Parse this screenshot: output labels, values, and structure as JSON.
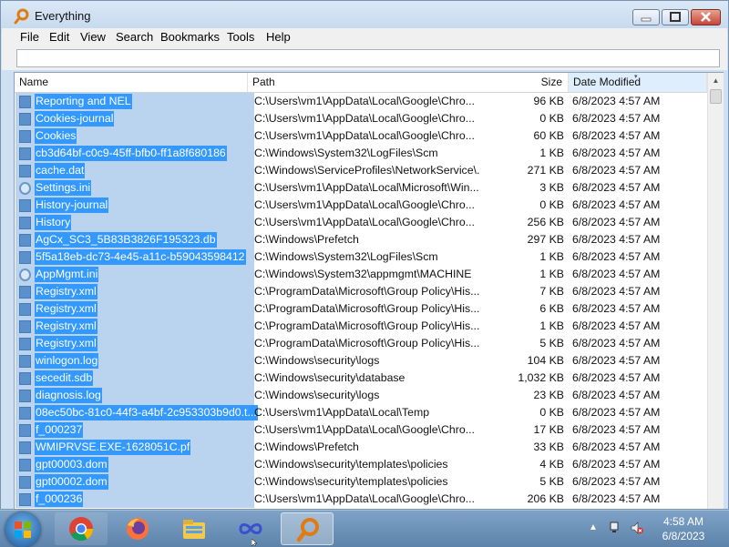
{
  "window": {
    "title": "Everything"
  },
  "menu": [
    "File",
    "Edit",
    "View",
    "Search",
    "Bookmarks",
    "Tools",
    "Help"
  ],
  "search": {
    "value": "",
    "placeholder": ""
  },
  "columns": {
    "name": "Name",
    "path": "Path",
    "size": "Size",
    "date": "Date Modified",
    "sorted_by": "Date Modified"
  },
  "rows": [
    {
      "name": "Reporting and NEL",
      "icon": "file-icon",
      "path": "C:\\Users\\vm1\\AppData\\Local\\Google\\Chro...",
      "size": "96 KB",
      "date": "6/8/2023 4:57 AM"
    },
    {
      "name": "Cookies-journal",
      "icon": "file-icon",
      "path": "C:\\Users\\vm1\\AppData\\Local\\Google\\Chro...",
      "size": "0 KB",
      "date": "6/8/2023 4:57 AM"
    },
    {
      "name": "Cookies",
      "icon": "file-icon",
      "path": "C:\\Users\\vm1\\AppData\\Local\\Google\\Chro...",
      "size": "60 KB",
      "date": "6/8/2023 4:57 AM"
    },
    {
      "name": "cb3d64bf-c0c9-45ff-bfb0-ff1a8f680186",
      "icon": "file-icon",
      "path": "C:\\Windows\\System32\\LogFiles\\Scm",
      "size": "1 KB",
      "date": "6/8/2023 4:57 AM"
    },
    {
      "name": "cache.dat",
      "icon": "file-icon",
      "path": "C:\\Windows\\ServiceProfiles\\NetworkService\\...",
      "size": "271 KB",
      "date": "6/8/2023 4:57 AM"
    },
    {
      "name": "Settings.ini",
      "icon": "settings-file-icon",
      "path": "C:\\Users\\vm1\\AppData\\Local\\Microsoft\\Win...",
      "size": "3 KB",
      "date": "6/8/2023 4:57 AM"
    },
    {
      "name": "History-journal",
      "icon": "file-icon",
      "path": "C:\\Users\\vm1\\AppData\\Local\\Google\\Chro...",
      "size": "0 KB",
      "date": "6/8/2023 4:57 AM"
    },
    {
      "name": "History",
      "icon": "file-icon",
      "path": "C:\\Users\\vm1\\AppData\\Local\\Google\\Chro...",
      "size": "256 KB",
      "date": "6/8/2023 4:57 AM"
    },
    {
      "name": "AgCx_SC3_5B83B3826F195323.db",
      "icon": "file-icon",
      "path": "C:\\Windows\\Prefetch",
      "size": "297 KB",
      "date": "6/8/2023 4:57 AM"
    },
    {
      "name": "5f5a18eb-dc73-4e45-a11c-b59043598412",
      "icon": "file-icon",
      "path": "C:\\Windows\\System32\\LogFiles\\Scm",
      "size": "1 KB",
      "date": "6/8/2023 4:57 AM"
    },
    {
      "name": "AppMgmt.ini",
      "icon": "settings-file-icon",
      "path": "C:\\Windows\\System32\\appmgmt\\MACHINE",
      "size": "1 KB",
      "date": "6/8/2023 4:57 AM"
    },
    {
      "name": "Registry.xml",
      "icon": "file-icon",
      "path": "C:\\ProgramData\\Microsoft\\Group Policy\\His...",
      "size": "7 KB",
      "date": "6/8/2023 4:57 AM"
    },
    {
      "name": "Registry.xml",
      "icon": "file-icon",
      "path": "C:\\ProgramData\\Microsoft\\Group Policy\\His...",
      "size": "6 KB",
      "date": "6/8/2023 4:57 AM"
    },
    {
      "name": "Registry.xml",
      "icon": "file-icon",
      "path": "C:\\ProgramData\\Microsoft\\Group Policy\\His...",
      "size": "1 KB",
      "date": "6/8/2023 4:57 AM"
    },
    {
      "name": "Registry.xml",
      "icon": "file-icon",
      "path": "C:\\ProgramData\\Microsoft\\Group Policy\\His...",
      "size": "5 KB",
      "date": "6/8/2023 4:57 AM"
    },
    {
      "name": "winlogon.log",
      "icon": "file-icon",
      "path": "C:\\Windows\\security\\logs",
      "size": "104 KB",
      "date": "6/8/2023 4:57 AM"
    },
    {
      "name": "secedit.sdb",
      "icon": "file-icon",
      "path": "C:\\Windows\\security\\database",
      "size": "1,032 KB",
      "date": "6/8/2023 4:57 AM"
    },
    {
      "name": "diagnosis.log",
      "icon": "file-icon",
      "path": "C:\\Windows\\security\\logs",
      "size": "23 KB",
      "date": "6/8/2023 4:57 AM"
    },
    {
      "name": "08ec50bc-81c0-44f3-a4bf-2c953303b9d0.t...",
      "icon": "file-icon",
      "path": "C:\\Users\\vm1\\AppData\\Local\\Temp",
      "size": "0 KB",
      "date": "6/8/2023 4:57 AM"
    },
    {
      "name": "f_000237",
      "icon": "file-icon",
      "path": "C:\\Users\\vm1\\AppData\\Local\\Google\\Chro...",
      "size": "17 KB",
      "date": "6/8/2023 4:57 AM"
    },
    {
      "name": "WMIPRVSE.EXE-1628051C.pf",
      "icon": "file-icon",
      "path": "C:\\Windows\\Prefetch",
      "size": "33 KB",
      "date": "6/8/2023 4:57 AM"
    },
    {
      "name": "gpt00003.dom",
      "icon": "file-icon",
      "path": "C:\\Windows\\security\\templates\\policies",
      "size": "4 KB",
      "date": "6/8/2023 4:57 AM"
    },
    {
      "name": "gpt00002.dom",
      "icon": "file-icon",
      "path": "C:\\Windows\\security\\templates\\policies",
      "size": "5 KB",
      "date": "6/8/2023 4:57 AM"
    },
    {
      "name": "f_000236",
      "icon": "file-icon",
      "path": "C:\\Users\\vm1\\AppData\\Local\\Google\\Chro...",
      "size": "206 KB",
      "date": "6/8/2023 4:57 AM"
    }
  ],
  "taskbar": {
    "apps": [
      {
        "name": "chrome-icon",
        "active": false
      },
      {
        "name": "firefox-icon",
        "active": false
      },
      {
        "name": "file-explorer-icon",
        "active": false
      },
      {
        "name": "infinity-app-icon",
        "active": false
      },
      {
        "name": "everything-search-icon",
        "active": true
      }
    ],
    "clock": {
      "time": "4:58 AM",
      "date": "6/8/2023"
    }
  },
  "colors": {
    "selection": "#3399ff",
    "selection_row": "#bad3ef",
    "taskbar": "#6a8fb3"
  }
}
